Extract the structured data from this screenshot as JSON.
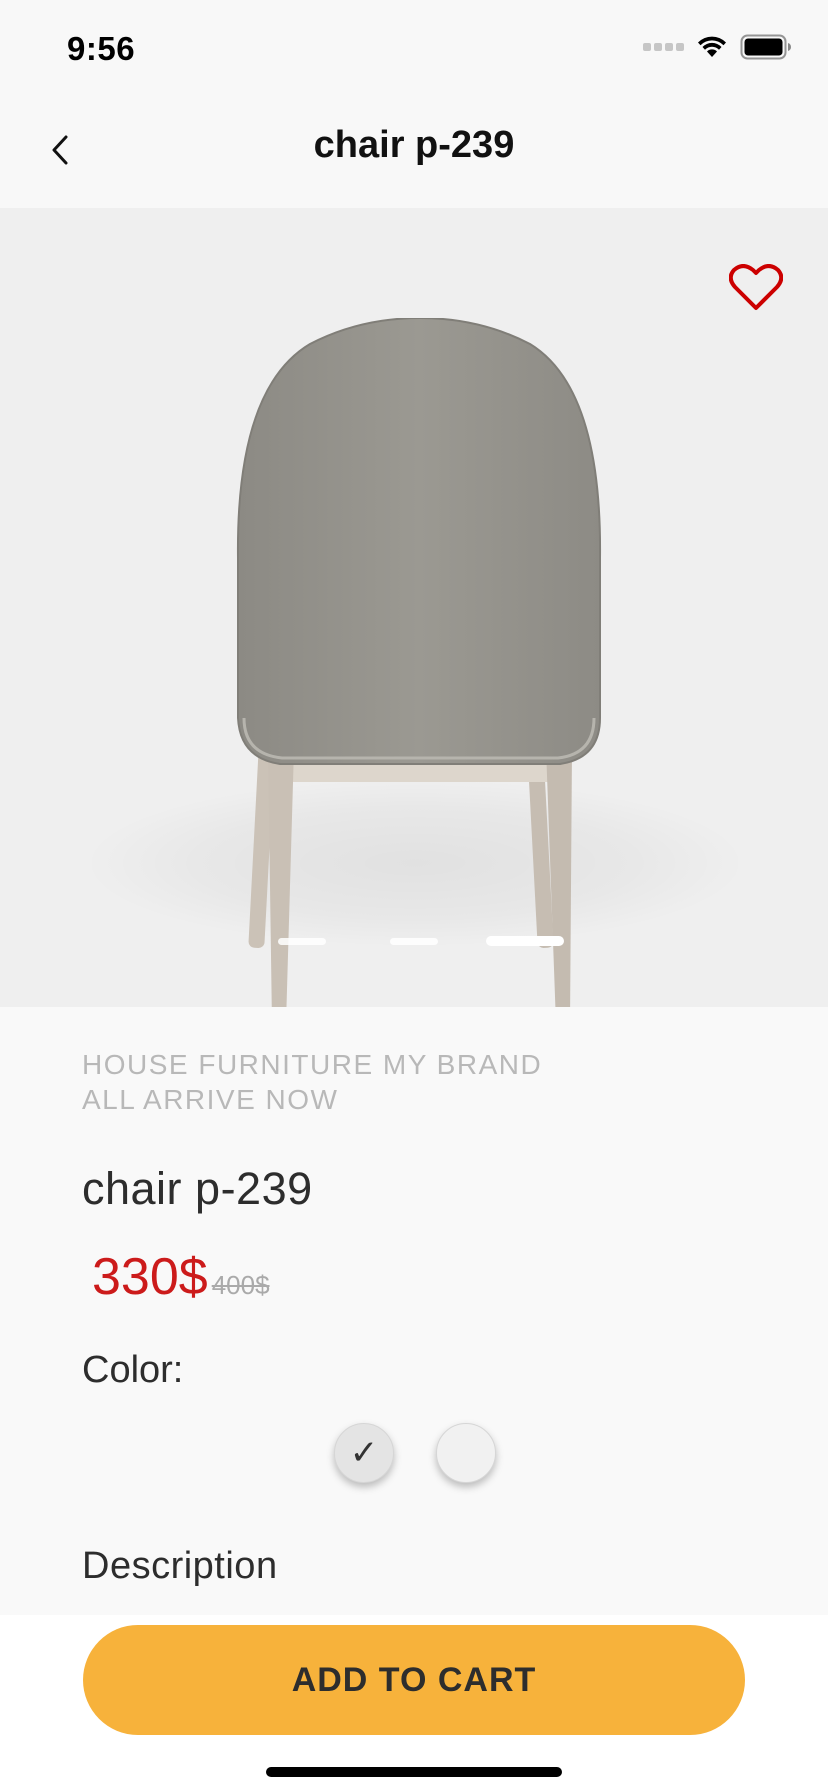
{
  "status_bar": {
    "time": "9:56"
  },
  "nav": {
    "title": "chair p-239"
  },
  "gallery": {
    "image_count": 3,
    "active_index": 2
  },
  "product": {
    "brand_line_1": "HOUSE FURNITURE MY BRAND",
    "brand_line_2": "ALL ARRIVE NOW",
    "name": "chair p-239",
    "price_current": "330$",
    "price_old": "400$",
    "color_label": "Color:",
    "selected_check": "✓",
    "description_heading": "Description"
  },
  "actions": {
    "add_to_cart": "ADD TO CART"
  },
  "colors": {
    "accent": "#f7b23b",
    "price": "#cc1b1b",
    "favorite": "#cc0000"
  }
}
